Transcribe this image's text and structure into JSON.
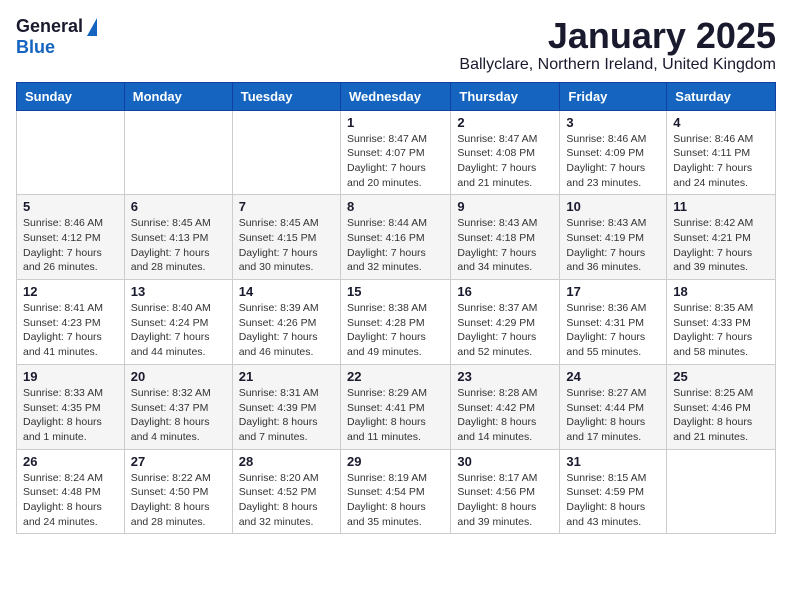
{
  "header": {
    "logo_general": "General",
    "logo_blue": "Blue",
    "month_title": "January 2025",
    "location": "Ballyclare, Northern Ireland, United Kingdom"
  },
  "weekdays": [
    "Sunday",
    "Monday",
    "Tuesday",
    "Wednesday",
    "Thursday",
    "Friday",
    "Saturday"
  ],
  "weeks": [
    [
      {
        "day": "",
        "info": ""
      },
      {
        "day": "",
        "info": ""
      },
      {
        "day": "",
        "info": ""
      },
      {
        "day": "1",
        "info": "Sunrise: 8:47 AM\nSunset: 4:07 PM\nDaylight: 7 hours\nand 20 minutes."
      },
      {
        "day": "2",
        "info": "Sunrise: 8:47 AM\nSunset: 4:08 PM\nDaylight: 7 hours\nand 21 minutes."
      },
      {
        "day": "3",
        "info": "Sunrise: 8:46 AM\nSunset: 4:09 PM\nDaylight: 7 hours\nand 23 minutes."
      },
      {
        "day": "4",
        "info": "Sunrise: 8:46 AM\nSunset: 4:11 PM\nDaylight: 7 hours\nand 24 minutes."
      }
    ],
    [
      {
        "day": "5",
        "info": "Sunrise: 8:46 AM\nSunset: 4:12 PM\nDaylight: 7 hours\nand 26 minutes."
      },
      {
        "day": "6",
        "info": "Sunrise: 8:45 AM\nSunset: 4:13 PM\nDaylight: 7 hours\nand 28 minutes."
      },
      {
        "day": "7",
        "info": "Sunrise: 8:45 AM\nSunset: 4:15 PM\nDaylight: 7 hours\nand 30 minutes."
      },
      {
        "day": "8",
        "info": "Sunrise: 8:44 AM\nSunset: 4:16 PM\nDaylight: 7 hours\nand 32 minutes."
      },
      {
        "day": "9",
        "info": "Sunrise: 8:43 AM\nSunset: 4:18 PM\nDaylight: 7 hours\nand 34 minutes."
      },
      {
        "day": "10",
        "info": "Sunrise: 8:43 AM\nSunset: 4:19 PM\nDaylight: 7 hours\nand 36 minutes."
      },
      {
        "day": "11",
        "info": "Sunrise: 8:42 AM\nSunset: 4:21 PM\nDaylight: 7 hours\nand 39 minutes."
      }
    ],
    [
      {
        "day": "12",
        "info": "Sunrise: 8:41 AM\nSunset: 4:23 PM\nDaylight: 7 hours\nand 41 minutes."
      },
      {
        "day": "13",
        "info": "Sunrise: 8:40 AM\nSunset: 4:24 PM\nDaylight: 7 hours\nand 44 minutes."
      },
      {
        "day": "14",
        "info": "Sunrise: 8:39 AM\nSunset: 4:26 PM\nDaylight: 7 hours\nand 46 minutes."
      },
      {
        "day": "15",
        "info": "Sunrise: 8:38 AM\nSunset: 4:28 PM\nDaylight: 7 hours\nand 49 minutes."
      },
      {
        "day": "16",
        "info": "Sunrise: 8:37 AM\nSunset: 4:29 PM\nDaylight: 7 hours\nand 52 minutes."
      },
      {
        "day": "17",
        "info": "Sunrise: 8:36 AM\nSunset: 4:31 PM\nDaylight: 7 hours\nand 55 minutes."
      },
      {
        "day": "18",
        "info": "Sunrise: 8:35 AM\nSunset: 4:33 PM\nDaylight: 7 hours\nand 58 minutes."
      }
    ],
    [
      {
        "day": "19",
        "info": "Sunrise: 8:33 AM\nSunset: 4:35 PM\nDaylight: 8 hours\nand 1 minute."
      },
      {
        "day": "20",
        "info": "Sunrise: 8:32 AM\nSunset: 4:37 PM\nDaylight: 8 hours\nand 4 minutes."
      },
      {
        "day": "21",
        "info": "Sunrise: 8:31 AM\nSunset: 4:39 PM\nDaylight: 8 hours\nand 7 minutes."
      },
      {
        "day": "22",
        "info": "Sunrise: 8:29 AM\nSunset: 4:41 PM\nDaylight: 8 hours\nand 11 minutes."
      },
      {
        "day": "23",
        "info": "Sunrise: 8:28 AM\nSunset: 4:42 PM\nDaylight: 8 hours\nand 14 minutes."
      },
      {
        "day": "24",
        "info": "Sunrise: 8:27 AM\nSunset: 4:44 PM\nDaylight: 8 hours\nand 17 minutes."
      },
      {
        "day": "25",
        "info": "Sunrise: 8:25 AM\nSunset: 4:46 PM\nDaylight: 8 hours\nand 21 minutes."
      }
    ],
    [
      {
        "day": "26",
        "info": "Sunrise: 8:24 AM\nSunset: 4:48 PM\nDaylight: 8 hours\nand 24 minutes."
      },
      {
        "day": "27",
        "info": "Sunrise: 8:22 AM\nSunset: 4:50 PM\nDaylight: 8 hours\nand 28 minutes."
      },
      {
        "day": "28",
        "info": "Sunrise: 8:20 AM\nSunset: 4:52 PM\nDaylight: 8 hours\nand 32 minutes."
      },
      {
        "day": "29",
        "info": "Sunrise: 8:19 AM\nSunset: 4:54 PM\nDaylight: 8 hours\nand 35 minutes."
      },
      {
        "day": "30",
        "info": "Sunrise: 8:17 AM\nSunset: 4:56 PM\nDaylight: 8 hours\nand 39 minutes."
      },
      {
        "day": "31",
        "info": "Sunrise: 8:15 AM\nSunset: 4:59 PM\nDaylight: 8 hours\nand 43 minutes."
      },
      {
        "day": "",
        "info": ""
      }
    ]
  ]
}
